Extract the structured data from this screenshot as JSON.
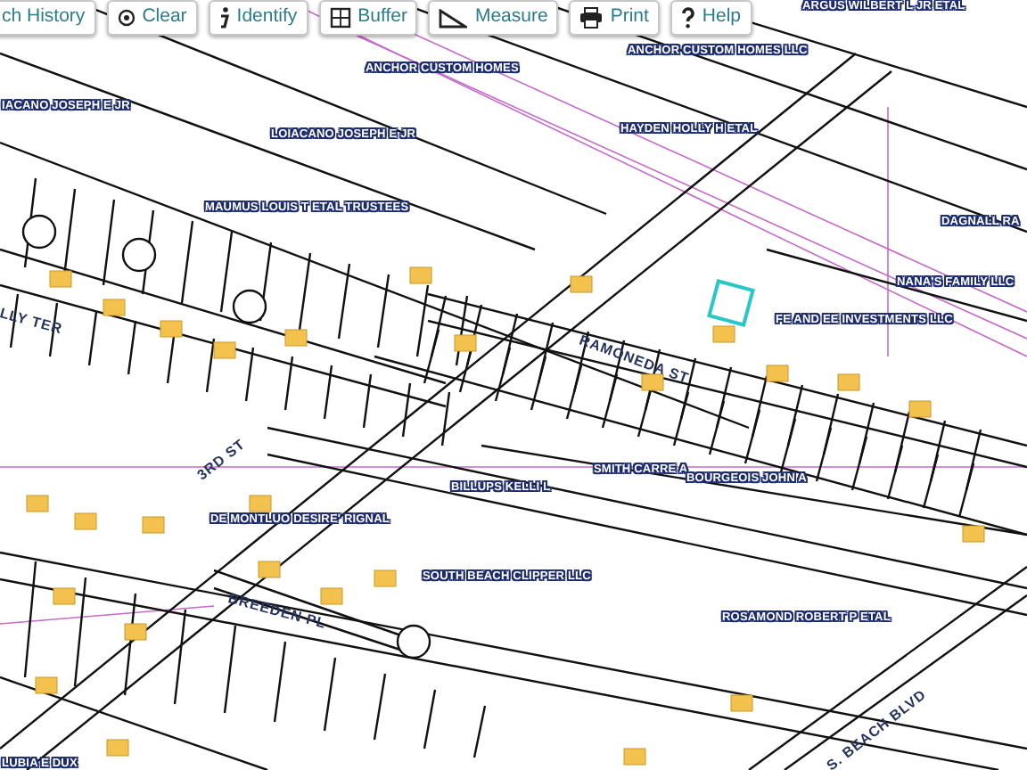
{
  "toolbar": [
    {
      "kind": "history",
      "label": "ch History"
    },
    {
      "kind": "clear",
      "label": "Clear"
    },
    {
      "kind": "identify",
      "label": "Identify"
    },
    {
      "kind": "buffer",
      "label": "Buffer"
    },
    {
      "kind": "measure",
      "label": "Measure"
    },
    {
      "kind": "print",
      "label": "Print"
    },
    {
      "kind": "help",
      "label": "Help"
    }
  ],
  "map": {
    "owner_labels": [
      {
        "text": "ARGUS WILBERT L JR ETAL"
      },
      {
        "text": "ANCHOR CUSTOM HOMES LLC"
      },
      {
        "text": "ANCHOR CUSTOM HOMES"
      },
      {
        "text": "IACANO JOSEPH E JR"
      },
      {
        "text": "LOIACANO JOSEPH E JR"
      },
      {
        "text": "HAYDEN HOLLY H ETAL"
      },
      {
        "text": "MAUMUS LOUIS T ETAL TRUSTEES"
      },
      {
        "text": "DAGNALL RA"
      },
      {
        "text": "NANA'S FAMILY LLC"
      },
      {
        "text": "FE AND EE INVESTMENTS LLC"
      },
      {
        "text": "SMITH CARRE A"
      },
      {
        "text": "BOURGEOIS JOHN A"
      },
      {
        "text": "BILLUPS KELLI L"
      },
      {
        "text": "DE MONTLUO DESIRE' RIGNAL"
      },
      {
        "text": "SOUTH BEACH CLIPPER LLC"
      },
      {
        "text": "ROSAMOND ROBERT P ETAL"
      },
      {
        "text": "LUBIA E DUX"
      }
    ],
    "street_labels": [
      {
        "text": "LLY TER"
      },
      {
        "text": "RAMONEDA ST"
      },
      {
        "text": "3RD ST"
      },
      {
        "text": "BREEDEN PL"
      },
      {
        "text": "S. BEACH BLVD"
      }
    ]
  }
}
